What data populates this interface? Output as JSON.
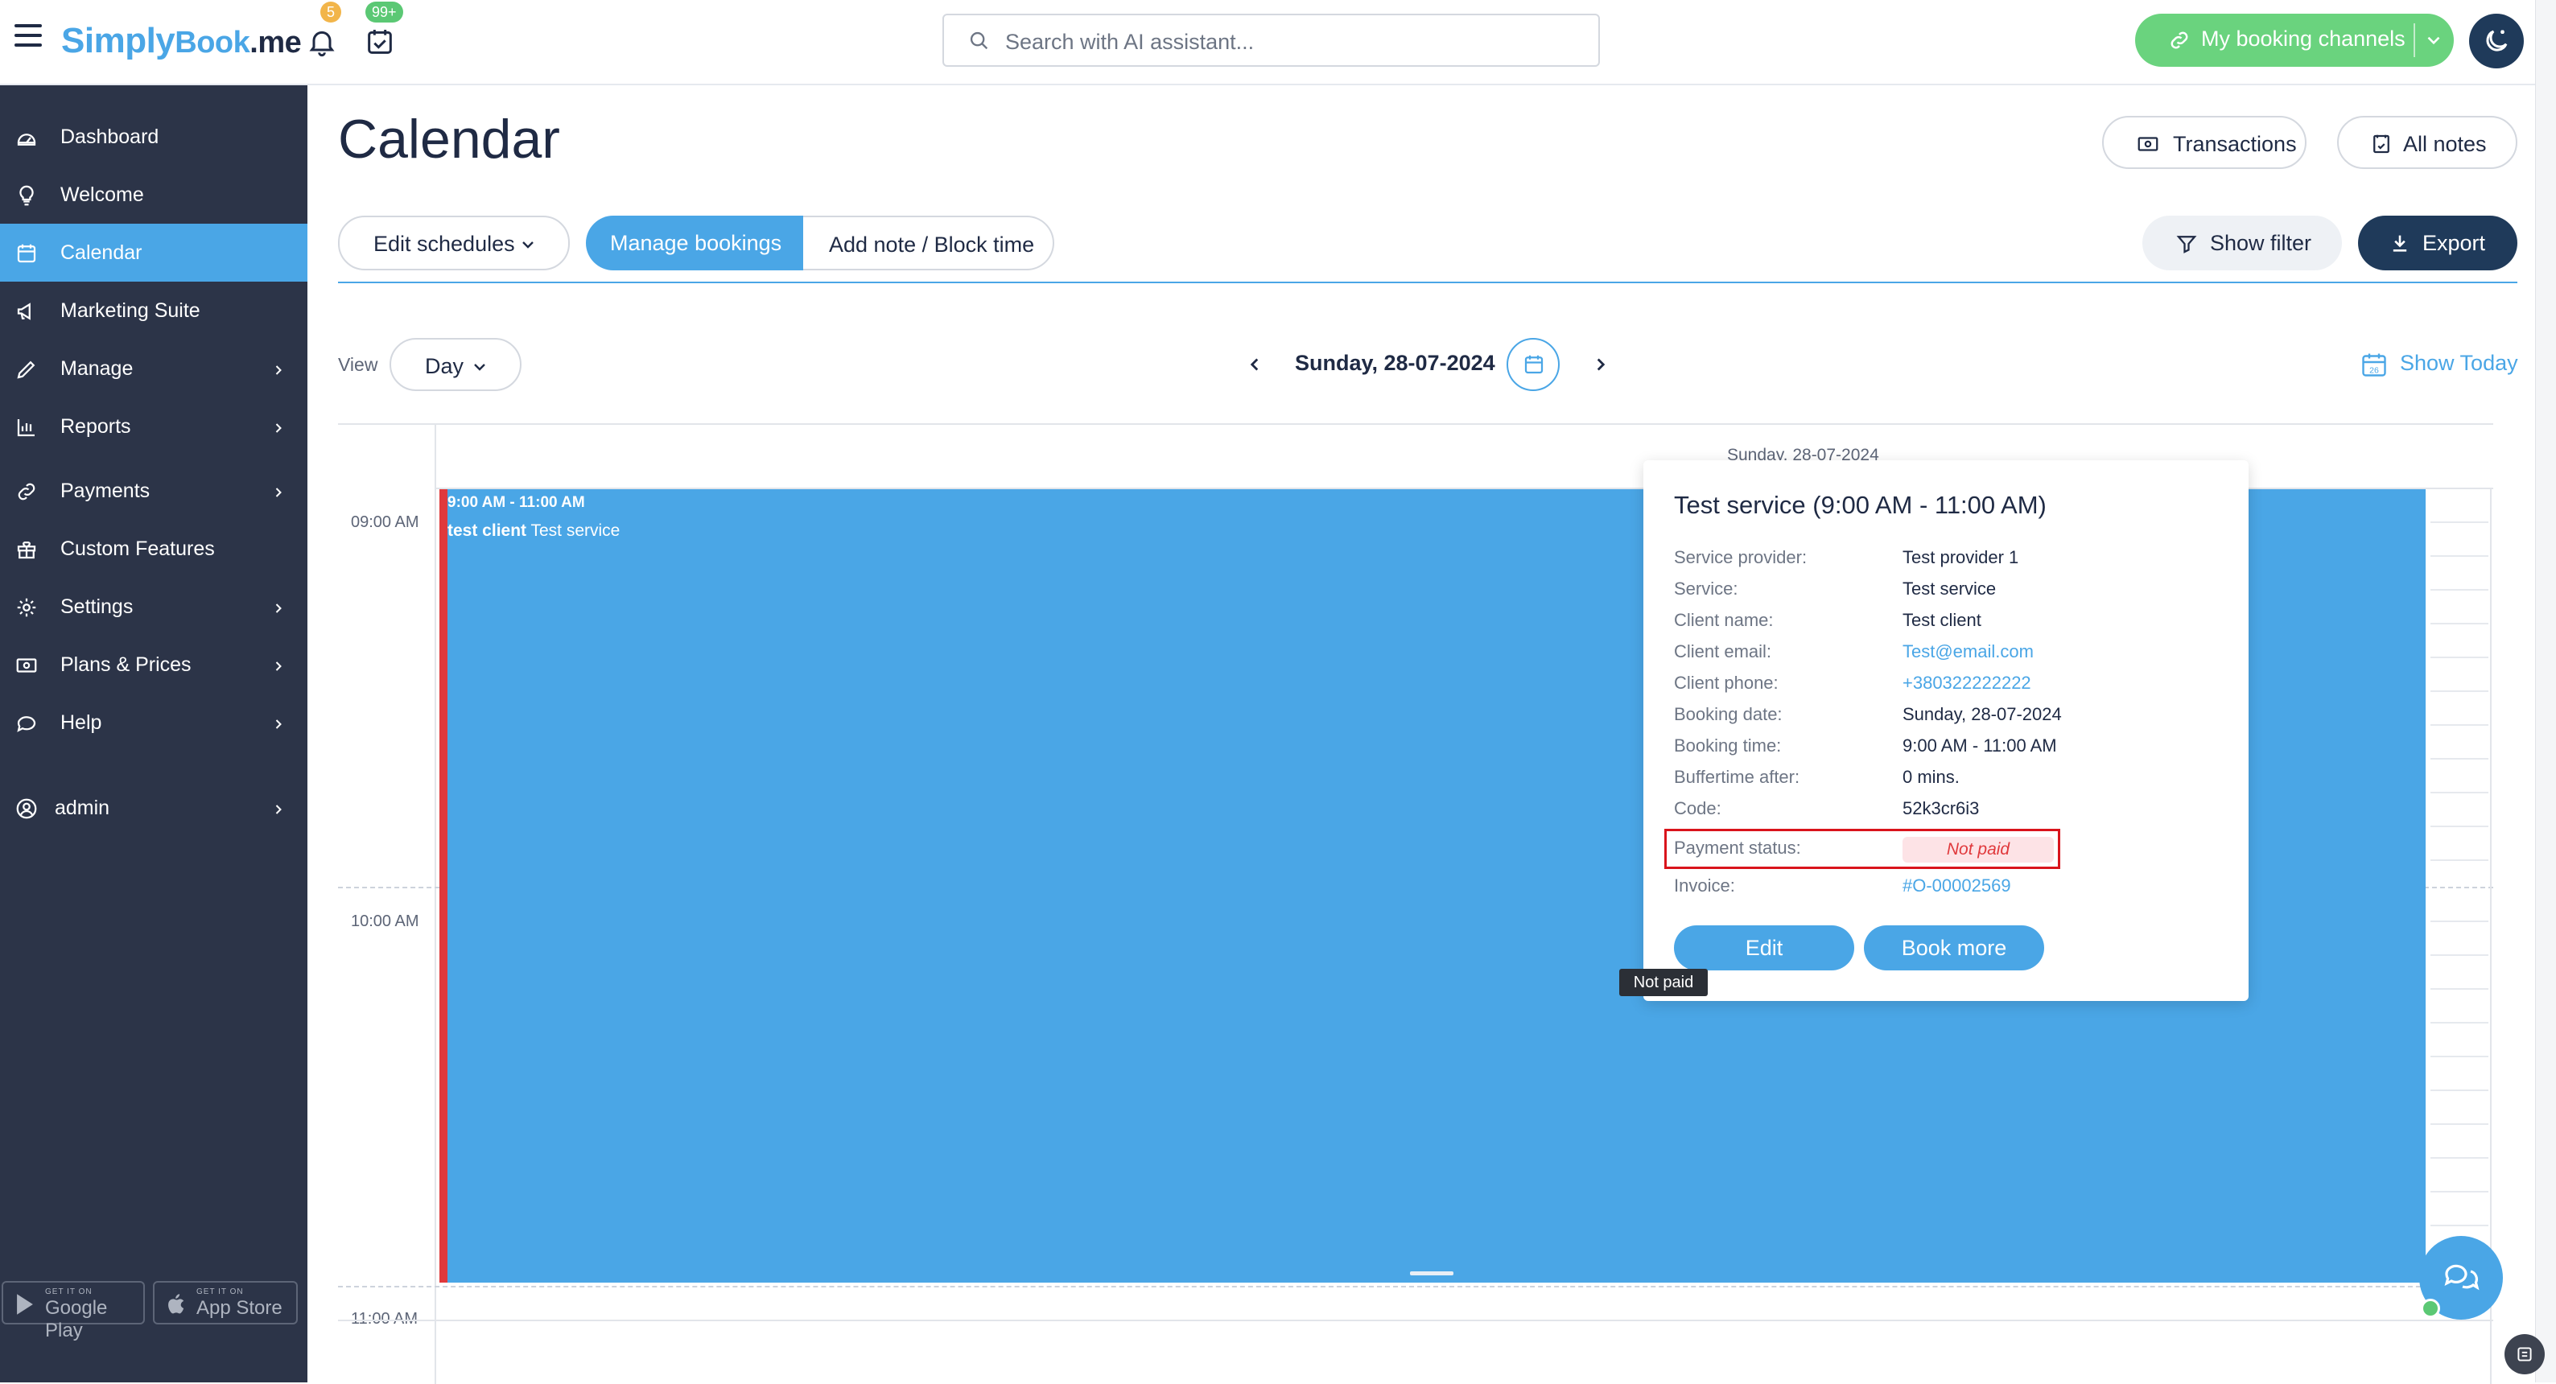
{
  "app": {
    "logo_prefix": "Simply",
    "logo_mid": "Book",
    "logo_suffix": ".me",
    "notifications_badge": "5",
    "tasks_badge": "99+",
    "search_placeholder": "Search with AI assistant...",
    "channels_label": "My booking channels"
  },
  "sidebar": {
    "items": [
      {
        "label": "Dashboard",
        "icon": "gauge-icon",
        "arrow": false,
        "active": false
      },
      {
        "label": "Welcome",
        "icon": "lightbulb-icon",
        "arrow": false,
        "active": false
      },
      {
        "label": "Calendar",
        "icon": "calendar-icon",
        "arrow": false,
        "active": true
      },
      {
        "label": "Marketing Suite",
        "icon": "megaphone-icon",
        "arrow": false,
        "active": false
      },
      {
        "label": "Manage",
        "icon": "pencil-icon",
        "arrow": true,
        "active": false
      },
      {
        "label": "Reports",
        "icon": "bar-chart-icon",
        "arrow": true,
        "active": false
      },
      {
        "label": "Payments",
        "icon": "link-icon",
        "arrow": true,
        "active": false
      },
      {
        "label": "Custom Features",
        "icon": "gift-icon",
        "arrow": false,
        "active": false
      },
      {
        "label": "Settings",
        "icon": "gear-icon",
        "arrow": true,
        "active": false
      },
      {
        "label": "Plans & Prices",
        "icon": "banknote-icon",
        "arrow": true,
        "active": false
      },
      {
        "label": "Help",
        "icon": "chat-icon",
        "arrow": true,
        "active": false
      }
    ],
    "user": "admin",
    "google_play_small": "GET IT ON",
    "google_play": "Google Play",
    "app_store_small": "GET IT ON",
    "app_store": "App Store"
  },
  "header": {
    "title": "Calendar",
    "transactions": "Transactions",
    "all_notes": "All notes",
    "edit_schedules": "Edit schedules",
    "manage_bookings": "Manage bookings",
    "add_note": "Add note / Block time",
    "show_filter": "Show filter",
    "export": "Export"
  },
  "toolbar": {
    "view_label": "View",
    "view_value": "Day",
    "date": "Sunday, 28-07-2024",
    "show_today": "Show Today",
    "today_icon_num": "26"
  },
  "grid": {
    "column_header": "Sunday, 28-07-2024",
    "times": [
      "09:00 AM",
      "10:00 AM",
      "11:00 AM"
    ]
  },
  "booking": {
    "time": "9:00 AM - 11:00 AM",
    "client": "test client",
    "service": "Test service"
  },
  "popover": {
    "title": "Test service (9:00 AM - 11:00 AM)",
    "rows": [
      {
        "k": "Service provider:",
        "v": "Test provider 1",
        "link": false
      },
      {
        "k": "Service:",
        "v": "Test service",
        "link": false
      },
      {
        "k": "Client name:",
        "v": "Test client",
        "link": false
      },
      {
        "k": "Client email:",
        "v": "Test@email.com",
        "link": true
      },
      {
        "k": "Client phone:",
        "v": "+380322222222",
        "link": true
      },
      {
        "k": "Booking date:",
        "v": "Sunday, 28-07-2024",
        "link": false
      },
      {
        "k": "Booking time:",
        "v": "9:00 AM - 11:00 AM",
        "link": false
      },
      {
        "k": "Buffertime after:",
        "v": "0 mins.",
        "link": false
      },
      {
        "k": "Code:",
        "v": "52k3cr6i3",
        "link": false
      }
    ],
    "payment_label": "Payment status:",
    "payment_value": "Not paid",
    "invoice_label": "Invoice:",
    "invoice_value": "#O-00002569",
    "edit": "Edit",
    "book_more": "Book more"
  },
  "tooltip": "Not paid",
  "colors": {
    "accent": "#4aa6e6",
    "sidebar": "#2c3448",
    "dark_button": "#1f3a5a",
    "green": "#6ad37e",
    "booking_bar": "#e0393c",
    "not_paid": "#e0393c"
  }
}
